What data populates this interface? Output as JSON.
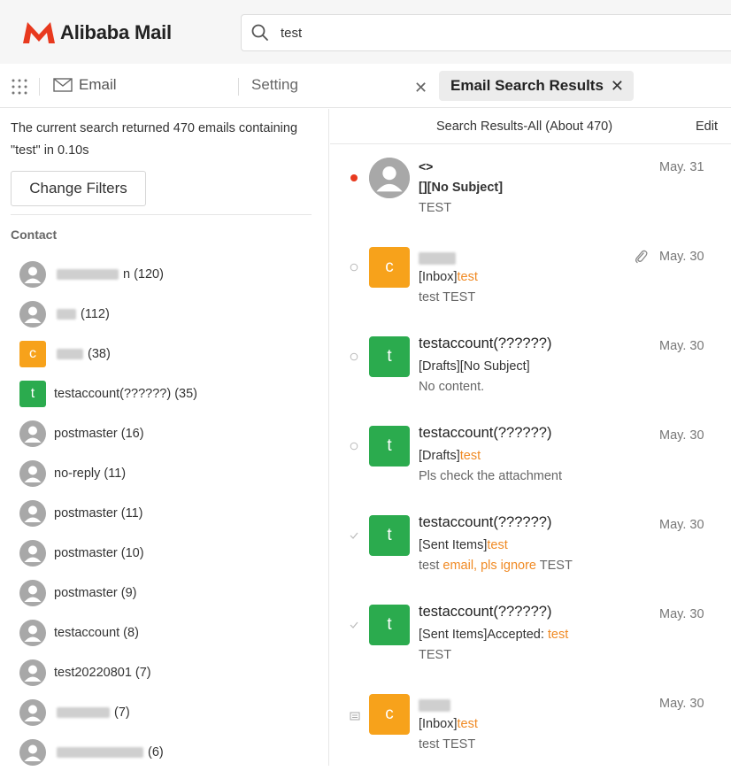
{
  "app": {
    "logo_text": "Alibaba Mail",
    "brand_color": "#e8391e"
  },
  "search": {
    "value": "test"
  },
  "tabs": {
    "email_label": "Email",
    "setting_label": "Setting",
    "active_label": "Email Search Results"
  },
  "left": {
    "summary": "The current search returned 470 emails containing \"test\" in 0.10s",
    "change_filters_label": "Change Filters",
    "contact_heading": "Contact",
    "contacts": [
      {
        "avatar": "person",
        "label": "n (120)"
      },
      {
        "avatar": "person",
        "label": "(112)"
      },
      {
        "avatar": "letter",
        "letter": "c",
        "color": "#f7a21b",
        "label": "(38)"
      },
      {
        "avatar": "letter",
        "letter": "t",
        "color": "#2bab4e",
        "label": "testaccount(??????) (35)"
      },
      {
        "avatar": "person",
        "label": "postmaster (16)"
      },
      {
        "avatar": "person",
        "label": "no-reply (11)"
      },
      {
        "avatar": "person",
        "label": "postmaster (11)"
      },
      {
        "avatar": "person",
        "label": "postmaster (10)"
      },
      {
        "avatar": "person",
        "label": "postmaster (9)"
      },
      {
        "avatar": "person",
        "label": "testaccount (8)"
      },
      {
        "avatar": "person",
        "label": "test20220801 (7)"
      },
      {
        "avatar": "person",
        "label": "(7)"
      },
      {
        "avatar": "person",
        "label": "(6)"
      }
    ]
  },
  "results": {
    "title": "Search Results-All (About 470)",
    "edit_label": "Edit",
    "mails": [
      {
        "status": "unread-dot",
        "avatar": "person",
        "sender": "<>",
        "subject": "[][No Subject]",
        "preview": "TEST",
        "date": "May. 31"
      },
      {
        "status": "circle",
        "avatar": "letter",
        "letter": "c",
        "color": "#f7a21b",
        "sender": "",
        "subject_prefix": "[Inbox]",
        "subject_hl": "test",
        "preview": "test TEST",
        "date": "May. 30",
        "attachment": true
      },
      {
        "status": "circle",
        "avatar": "letter",
        "letter": "t",
        "color": "#2bab4e",
        "sender": "testaccount(??????)",
        "subject": "[Drafts][No Subject]",
        "preview": "No content.",
        "date": "May. 30"
      },
      {
        "status": "circle",
        "avatar": "letter",
        "letter": "t",
        "color": "#2bab4e",
        "sender": "testaccount(??????)",
        "subject_prefix": "[Drafts]",
        "subject_hl": "test",
        "preview": "Pls check the attachment",
        "date": "May. 30"
      },
      {
        "status": "check",
        "avatar": "letter",
        "letter": "t",
        "color": "#2bab4e",
        "sender": "testaccount(??????)",
        "subject_prefix": "[Sent Items]",
        "subject_hl": "test",
        "preview_parts": [
          "test ",
          "email, pls ignore",
          " TEST"
        ],
        "date": "May. 30"
      },
      {
        "status": "check",
        "avatar": "letter",
        "letter": "t",
        "color": "#2bab4e",
        "sender": "testaccount(??????)",
        "subject_prefix": "[Sent Items]Accepted: ",
        "subject_hl": "test",
        "preview": "TEST",
        "date": "May. 30"
      },
      {
        "status": "draft-icon",
        "avatar": "letter",
        "letter": "c",
        "color": "#f7a21b",
        "sender": "",
        "subject_prefix": "[Inbox]",
        "subject_hl": "test",
        "preview": "test TEST",
        "date": "May. 30"
      }
    ]
  }
}
